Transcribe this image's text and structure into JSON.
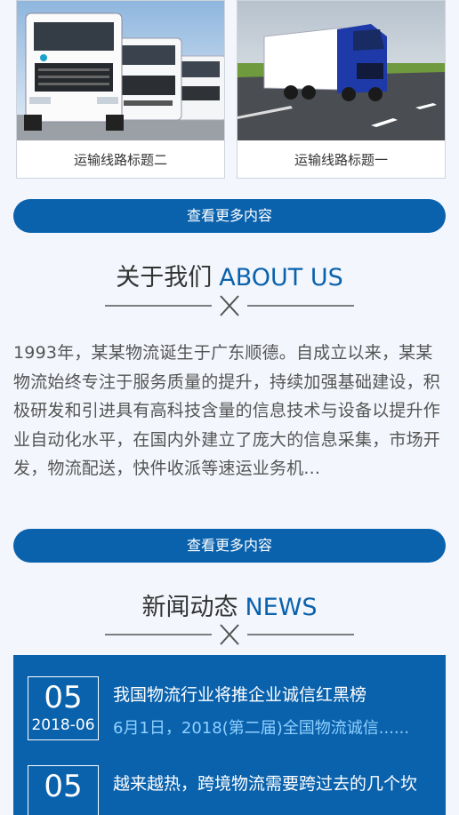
{
  "routes": [
    {
      "caption": "运输线路标题二",
      "image": "white-trucks-photo"
    },
    {
      "caption": "运输线路标题一",
      "image": "blue-truck-photo"
    }
  ],
  "more_button_label": "查看更多内容",
  "about": {
    "title_cn": "关于我们",
    "title_en": "ABOUT US",
    "text": "1993年，某某物流诞生于广东顺德。自成立以来，某某物流始终专注于服务质量的提升，持续加强基础建设，积极研发和引进具有高科技含量的信息技术与设备以提升作业自动化水平，在国内外建立了庞大的信息采集，市场开发，物流配送，快件收派等速运业务机..."
  },
  "news": {
    "title_cn": "新闻动态",
    "title_en": "NEWS",
    "items": [
      {
        "day": "05",
        "ym": "2018-06",
        "title": "我国物流行业将推企业诚信红黑榜",
        "summary": "6月1日，2018(第二届)全国物流诚信......"
      },
      {
        "day": "05",
        "ym": "",
        "title": "越来越热，跨境物流需要跨过去的几个坎",
        "summary": ""
      }
    ]
  },
  "colors": {
    "accent": "#0a62ad",
    "background": "#f3f6fc",
    "summary": "#8fd0ff"
  }
}
